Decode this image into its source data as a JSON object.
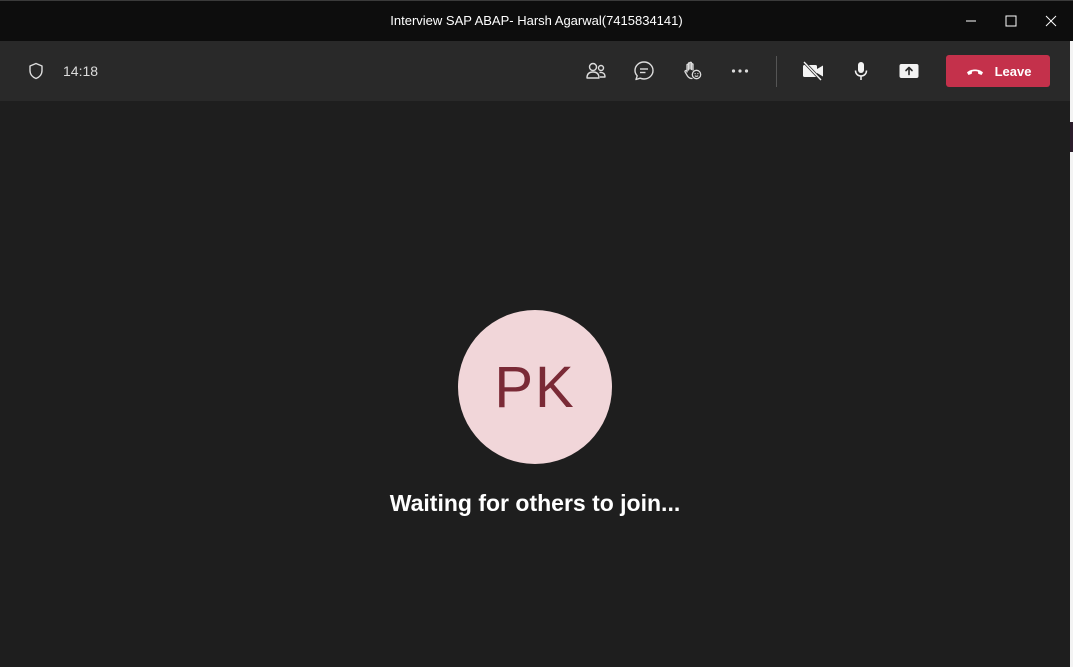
{
  "window": {
    "title": "Interview SAP ABAP- Harsh Agarwal(7415834141)"
  },
  "toolbar": {
    "meeting_timer": "14:18",
    "leave_label": "Leave",
    "icons": {
      "privacy": "shield-icon",
      "people": "people-icon",
      "chat": "chat-icon",
      "reactions": "raise-hand-icon",
      "more": "more-options-icon",
      "camera": "camera-off-icon",
      "mic": "microphone-icon",
      "share": "share-screen-icon",
      "leave": "phone-hangup-icon"
    }
  },
  "stage": {
    "avatar_initials": "PK",
    "status_message": "Waiting for others to join..."
  },
  "colors": {
    "leave_button": "#c4314b",
    "avatar_background": "#f1d6d9",
    "avatar_text": "#7a2a36",
    "toolbar_background": "#292929",
    "stage_background": "#1e1e1e"
  }
}
